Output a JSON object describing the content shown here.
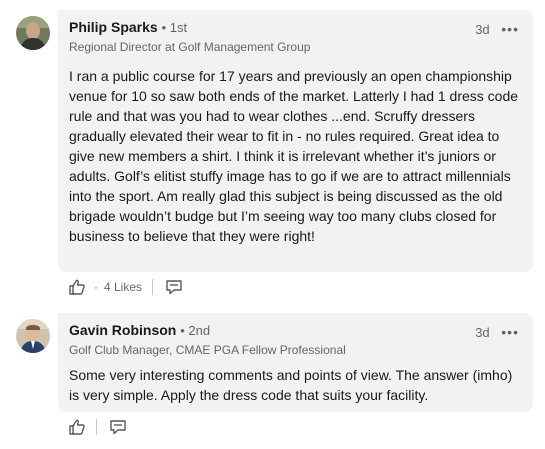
{
  "comments": [
    {
      "name": "Philip Sparks",
      "degree": "• 1st",
      "headline": "Regional Director at Golf Management Group",
      "time": "3d",
      "more": "•••",
      "text": "I ran a public course for 17 years and previously an open championship venue for 10 so saw both ends of the market. Latterly I had 1 dress code rule and that was you had to wear clothes ...end. Scruffy dressers gradually elevated their wear to fit in - no rules required. Great idea to give new members a shirt. I think it  is irrelevant whether it’s juniors or adults. Golf’s elitist stuffy image has to go if we are to attract millennials into the sport. Am really glad this subject is being discussed as the old brigade wouldn’t budge but I’m seeing way too many clubs closed for business to believe that they were right!",
      "likes_dot": "·",
      "likes": "4 Likes"
    },
    {
      "name": "Gavin Robinson",
      "degree": "• 2nd",
      "headline": "Golf Club Manager, CMAE PGA Fellow Professional",
      "time": "3d",
      "more": "•••",
      "text": "Some very interesting comments and points of view. The answer (imho) is very simple. Apply the dress code that suits your facility."
    }
  ]
}
